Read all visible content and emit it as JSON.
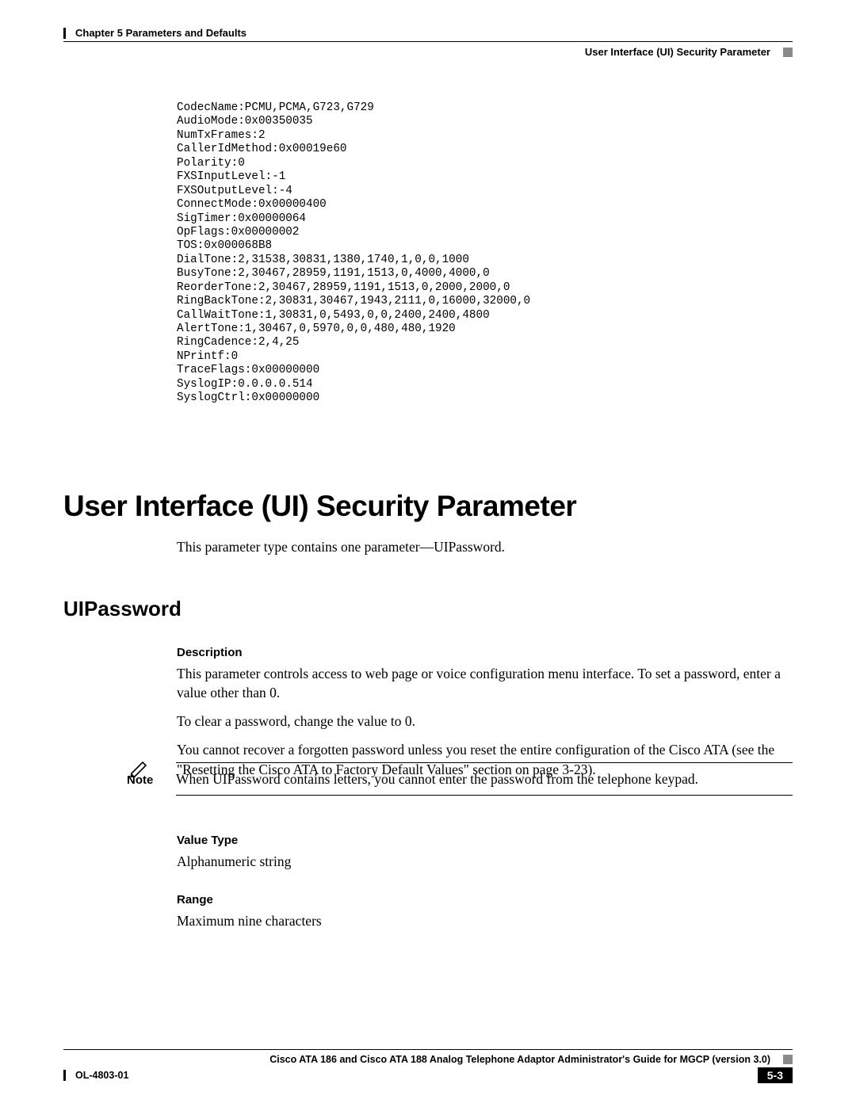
{
  "header": {
    "chapter": "Chapter 5      Parameters and Defaults",
    "breadcrumb": "User Interface (UI) Security Parameter"
  },
  "code": "CodecName:PCMU,PCMA,G723,G729\nAudioMode:0x00350035\nNumTxFrames:2\nCallerIdMethod:0x00019e60\nPolarity:0\nFXSInputLevel:-1\nFXSOutputLevel:-4\nConnectMode:0x00000400\nSigTimer:0x00000064\nOpFlags:0x00000002\nTOS:0x000068B8\nDialTone:2,31538,30831,1380,1740,1,0,0,1000\nBusyTone:2,30467,28959,1191,1513,0,4000,4000,0\nReorderTone:2,30467,28959,1191,1513,0,2000,2000,0\nRingBackTone:2,30831,30467,1943,2111,0,16000,32000,0\nCallWaitTone:1,30831,0,5493,0,0,2400,2400,4800\nAlertTone:1,30467,0,5970,0,0,480,480,1920\nRingCadence:2,4,25\nNPrintf:0\nTraceFlags:0x00000000\nSyslogIP:0.0.0.0.514\nSyslogCtrl:0x00000000",
  "h1": "User Interface (UI) Security Parameter",
  "h1_desc": "This parameter type contains one parameter—UIPassword.",
  "h2": "UIPassword",
  "description": {
    "label": "Description",
    "p1": "This parameter controls access to web page or voice configuration menu interface. To set a password, enter a value other than 0.",
    "p2": "To clear a password, change the value to 0.",
    "p3": "You cannot recover a forgotten password unless you reset the entire configuration of the Cisco ATA (see the \"Resetting the Cisco ATA to Factory Default Values\" section on page 3-23)."
  },
  "note": {
    "label": "Note",
    "text": "When UIPassword contains letters, you cannot enter the password from the telephone keypad."
  },
  "value_type": {
    "label": "Value Type",
    "text": "Alphanumeric string"
  },
  "range": {
    "label": "Range",
    "text": "Maximum nine characters"
  },
  "footer": {
    "title": "Cisco ATA 186 and Cisco ATA 188 Analog Telephone Adaptor Administrator's Guide for MGCP (version 3.0)",
    "doc_id": "OL-4803-01",
    "page": "5-3"
  }
}
